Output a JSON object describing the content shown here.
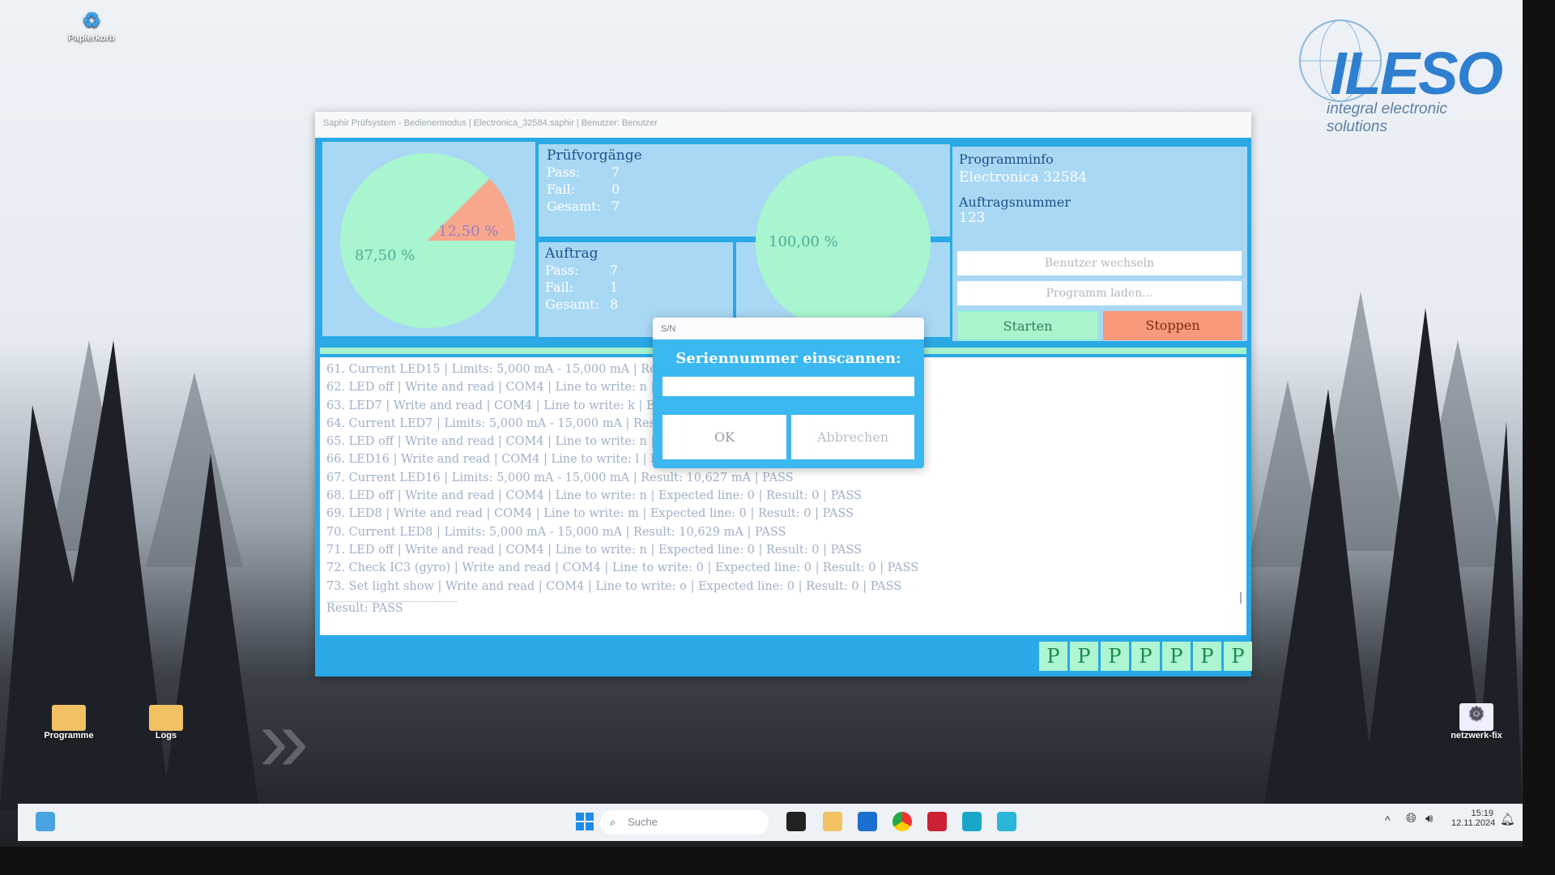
{
  "desktop": {
    "icons": [
      {
        "label": "Papierkorb"
      },
      {
        "label": "Programme"
      },
      {
        "label": "Logs"
      },
      {
        "label": "netzwerk-fix"
      }
    ],
    "logo": {
      "text": "ILESO",
      "tagline": "integral electronic solutions",
      "color": "#2f7fd0"
    }
  },
  "window": {
    "title": "Saphir Prüfsystem - Bedienermodus | Electronica_32584.saphir | Benutzer: Benutzer"
  },
  "pie_left": {
    "pass_label": "87,50 %",
    "fail_label": "12,50 %",
    "pass_fraction": 0.875,
    "pass_color": "#a8f5cf",
    "fail_color": "#f7a78c"
  },
  "pie_right": {
    "pass_label": "100,00 %",
    "pass_fraction": 1.0
  },
  "pruefvorgaenge": {
    "title": "Prüfvorgänge",
    "pass_label": "Pass:",
    "pass": "7",
    "fail_label": "Fail:",
    "fail": "0",
    "total_label": "Gesamt:",
    "total": "7"
  },
  "auftrag": {
    "title": "Auftrag",
    "pass_label": "Pass:",
    "pass": "7",
    "fail_label": "Fail:",
    "fail": "1",
    "total_label": "Gesamt:",
    "total": "8"
  },
  "programminfo": {
    "title": "Programminfo",
    "program": "Electronica 32584",
    "order_title": "Auftragsnummer",
    "order": "123",
    "switch_user": "Benutzer wechseln",
    "load_program": "Programm laden...",
    "start": "Starten",
    "stop": "Stoppen"
  },
  "log": {
    "lines": [
      "61. Current LED15 | Limits: 5,000 mA - 15,000 mA | Result: 1",
      "62. LED off | Write and read | COM4 | Line to write: n | Expe",
      "63. LED7 | Write and read | COM4 | Line to write: k | Expecte",
      "64. Current LED7 | Limits: 5,000 mA - 15,000 mA | Result: 10",
      "65. LED off | Write and read | COM4 | Line to write: n | Expe",
      "66. LED16 | Write and read | COM4 | Line to write: l | Expect",
      "67. Current LED16 | Limits: 5,000 mA - 15,000 mA | Result: 10,627 mA | PASS",
      "68. LED off | Write and read | COM4 | Line to write: n | Expected line: 0 | Result: 0 | PASS",
      "69. LED8 | Write and read | COM4 | Line to write: m | Expected line: 0 | Result: 0 | PASS",
      "70. Current LED8 | Limits: 5,000 mA - 15,000 mA | Result: 10,629 mA | PASS",
      "71. LED off | Write and read | COM4 | Line to write: n | Expected line: 0 | Result: 0 | PASS",
      "72. Check IC3 (gyro) | Write and read | COM4 | Line to write: 0 | Expected line: 0 | Result: 0 | PASS",
      "73. Set light show | Write and read | COM4 | Line to write: o | Expected line: 0 | Result: 0 | PASS"
    ],
    "separator": "------------------------------------------------------------",
    "result": "Result: PASS"
  },
  "history": [
    "P",
    "P",
    "P",
    "P",
    "P",
    "P",
    "P"
  ],
  "dialog": {
    "title": "S/N",
    "heading": "Seriennummer einscannen:",
    "input_value": "",
    "ok": "OK",
    "cancel": "Abbrechen"
  },
  "taskbar": {
    "search_placeholder": "Suche",
    "time": "15:19",
    "date": "12.11.2024"
  }
}
